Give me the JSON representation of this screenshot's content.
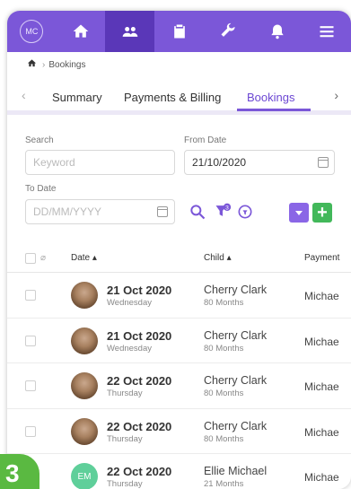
{
  "nav": {
    "logo_text": "MC"
  },
  "breadcrumb": {
    "current": "Bookings"
  },
  "tabs": [
    {
      "label": "Summary"
    },
    {
      "label": "Payments & Billing"
    },
    {
      "label": "Bookings"
    }
  ],
  "filters": {
    "search_label": "Search",
    "search_placeholder": "Keyword",
    "from_label": "From Date",
    "from_value": "21/10/2020",
    "to_label": "To Date",
    "to_placeholder": "DD/MM/YYYY",
    "filter_badge": "3"
  },
  "table": {
    "headers": {
      "date": "Date ▴",
      "child": "Child ▴",
      "payment": "Payment"
    },
    "rows": [
      {
        "date": "21 Oct 2020",
        "day": "Wednesday",
        "child": "Cherry Clark",
        "age": "80 Months",
        "payment": "Michae",
        "avatar": "photo"
      },
      {
        "date": "21 Oct 2020",
        "day": "Wednesday",
        "child": "Cherry Clark",
        "age": "80 Months",
        "payment": "Michae",
        "avatar": "photo"
      },
      {
        "date": "22 Oct 2020",
        "day": "Thursday",
        "child": "Cherry Clark",
        "age": "80 Months",
        "payment": "Michae",
        "avatar": "photo"
      },
      {
        "date": "22 Oct 2020",
        "day": "Thursday",
        "child": "Cherry Clark",
        "age": "80 Months",
        "payment": "Michae",
        "avatar": "photo"
      },
      {
        "date": "22 Oct 2020",
        "day": "Thursday",
        "child": "Ellie Michael",
        "age": "21 Months",
        "payment": "Michae",
        "avatar": "EM"
      }
    ]
  },
  "step_badge": "3",
  "colors": {
    "brand": "#7b57d8",
    "brand_active": "#5a37b8",
    "accent_green": "#42b85a",
    "step_green": "#5ab941"
  }
}
